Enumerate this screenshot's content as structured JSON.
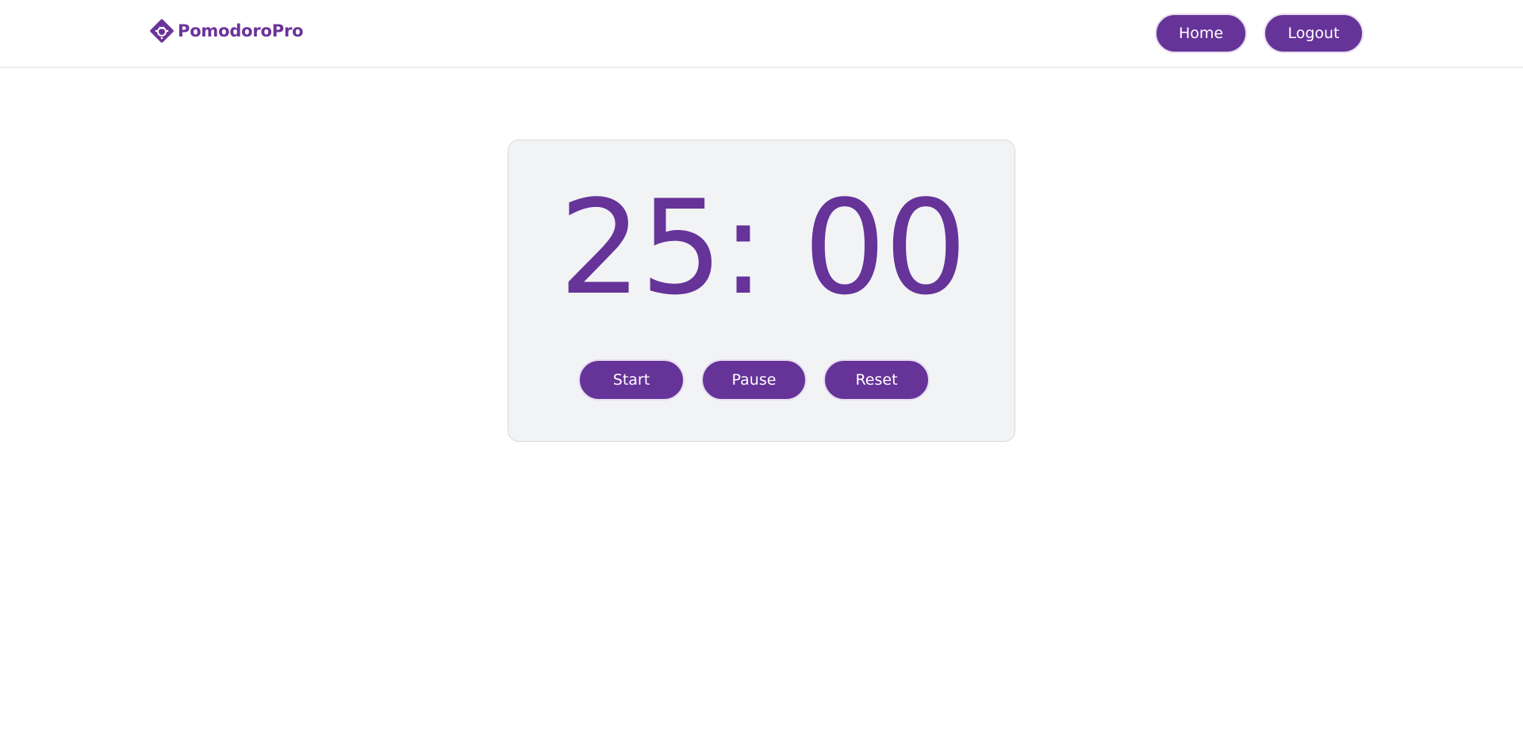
{
  "header": {
    "brand_name": "PomodoroPro",
    "brand_icon": "tomato-gear-logo-icon",
    "nav": {
      "home_label": "Home",
      "logout_label": "Logout"
    }
  },
  "timer": {
    "display": "25: 00"
  },
  "controls": {
    "start_label": "Start",
    "pause_label": "Pause",
    "reset_label": "Reset"
  },
  "colors": {
    "accent": "#663399",
    "card_background": "#f2f3f5",
    "page_background": "#ffffff"
  }
}
